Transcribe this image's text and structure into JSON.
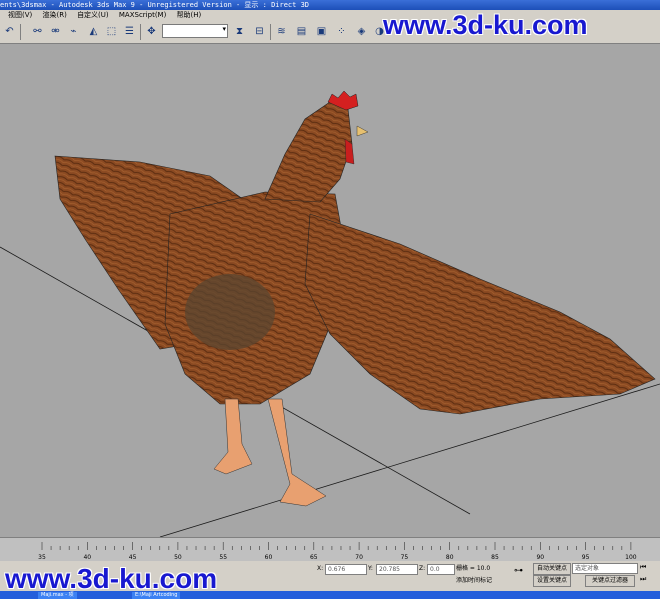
{
  "window": {
    "title": "ents\\3dsmax  -  Autodesk 3ds Max 9  - Unregistered Version   - 显示 : Direct 3D"
  },
  "menu": [
    "视图(V)",
    "渲染(R)",
    "自定义(U)",
    "MAXScript(M)",
    "帮助(H)"
  ],
  "toolbar": {
    "selection_dropdown": ""
  },
  "watermark": {
    "text": "www.3d-ku.com"
  },
  "timeline": {
    "ticks": [
      "35",
      "40",
      "45",
      "50",
      "55",
      "60",
      "65",
      "70",
      "75",
      "80",
      "85",
      "90",
      "95",
      "100"
    ]
  },
  "status": {
    "x_label": "X:",
    "x_value": "0.676",
    "y_label": "Y:",
    "y_value": "20.785",
    "z_label": "Z:",
    "z_value": "0.0",
    "grid": "栅格 = 10.0",
    "add_time_tag": "添加时间标记",
    "auto_key": "自动关键点",
    "set_key": "设置关键点",
    "selected_object": "选定对象",
    "key_filters": "关键点过滤器"
  },
  "taskbar": {
    "items": [
      "Maji.max - 项",
      "E:\\Maji Artcoding"
    ]
  },
  "colors": {
    "viewport_bg": "#a6a6a6",
    "hen_body": "#8b4a22",
    "comb": "#d42020"
  }
}
